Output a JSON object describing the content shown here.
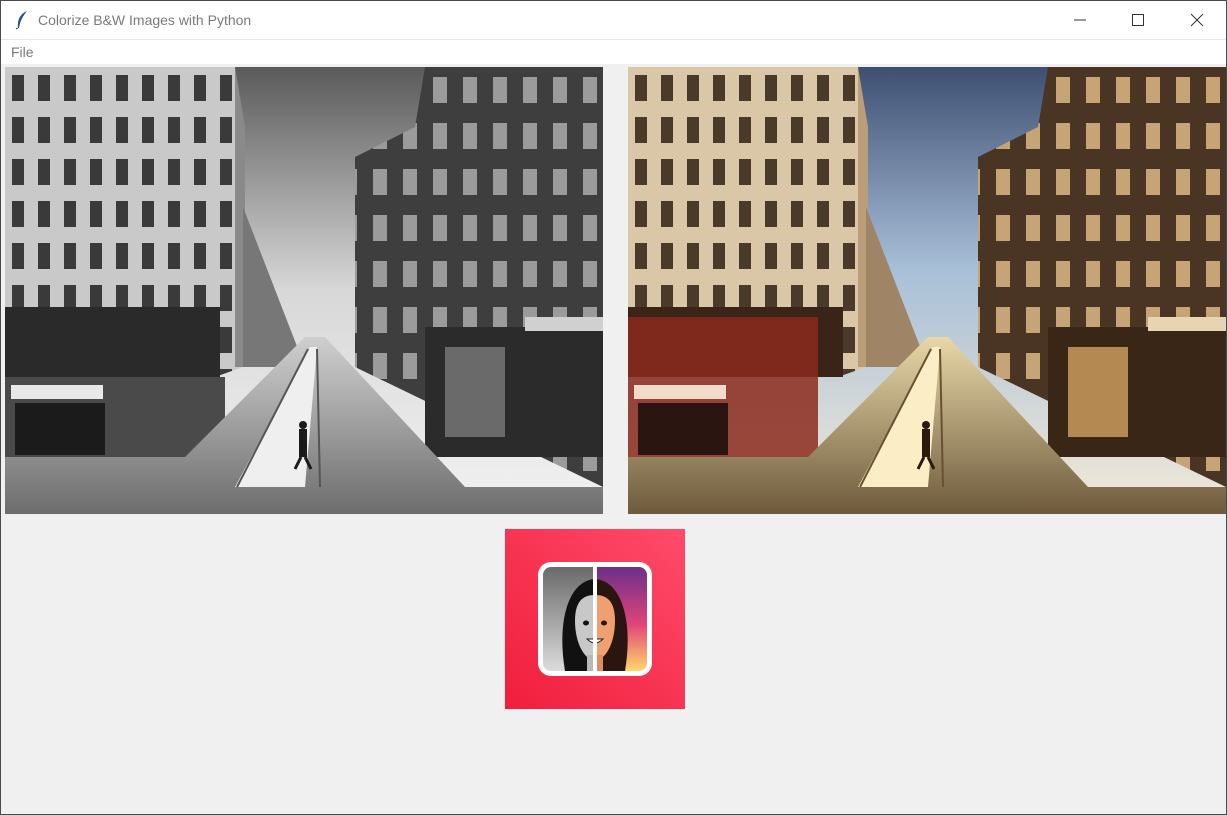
{
  "window": {
    "title": "Colorize B&W Images with Python",
    "icons": {
      "app": "feather-icon",
      "minimize": "minimize-icon",
      "maximize": "maximize-icon",
      "close": "close-icon"
    }
  },
  "menubar": {
    "items": [
      "File"
    ]
  },
  "main": {
    "original_image": {
      "kind": "grayscale street photo"
    },
    "colorized_image": {
      "kind": "colorized street photo"
    },
    "logo": {
      "icon": "bw-to-color-face-icon",
      "accent": "#f5314f"
    }
  },
  "colors": {
    "background": "#f0f0f0",
    "logo_gradient_top": "#ff4b6a",
    "logo_gradient_bottom": "#f01e3c"
  }
}
